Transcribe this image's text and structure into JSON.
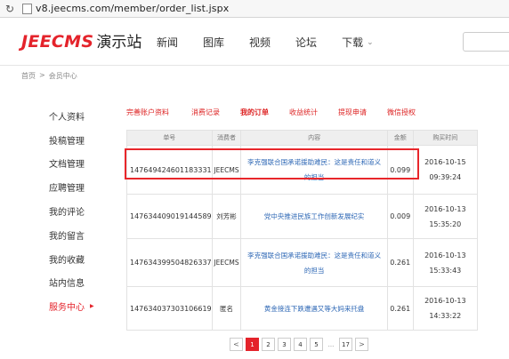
{
  "browser": {
    "url": "v8.jeecms.com/member/order_list.jspx"
  },
  "header": {
    "brand": "JEECMS",
    "site_name": "演示站",
    "nav": [
      "新闻",
      "图库",
      "视频",
      "论坛",
      "下载"
    ]
  },
  "breadcrumb": {
    "home": "首页",
    "sep": ">",
    "current": "会员中心"
  },
  "sidebar": {
    "items": [
      {
        "label": "个人资料"
      },
      {
        "label": "投稿管理"
      },
      {
        "label": "文档管理"
      },
      {
        "label": "应聘管理"
      },
      {
        "label": "我的评论"
      },
      {
        "label": "我的留言"
      },
      {
        "label": "我的收藏"
      },
      {
        "label": "站内信息"
      },
      {
        "label": "服务中心"
      }
    ]
  },
  "subtabs": [
    "完善账户资料",
    "消费记录",
    "我的订单",
    "收益统计",
    "提现申请",
    "微信授权"
  ],
  "table": {
    "headers": [
      "单号",
      "消费者",
      "内容",
      "金额",
      "购买时间"
    ],
    "rows": [
      {
        "order": "147649424601183331",
        "buyer": "JEECMS",
        "content": "李克强联合国承诺援助难民：这是责任和道义的担当",
        "amount": "0.099",
        "date": "2016-10-15",
        "time": "09:39:24"
      },
      {
        "order": "147634409019144589",
        "buyer": "刘芳彬",
        "content": "党中央推进民族工作创新发展纪实",
        "amount": "0.009",
        "date": "2016-10-13",
        "time": "15:35:20"
      },
      {
        "order": "147634399504826337",
        "buyer": "JEECMS",
        "content": "李克强联合国承诺援助难民：这是责任和道义的担当",
        "amount": "0.261",
        "date": "2016-10-13",
        "time": "15:33:43"
      },
      {
        "order": "147634037303106619",
        "buyer": "匿名",
        "content": "黄金接连下跌遭遇又等大妈来托盘",
        "amount": "0.261",
        "date": "2016-10-13",
        "time": "14:33:22"
      }
    ]
  },
  "pagination": {
    "prev": "<",
    "pages": [
      "1",
      "2",
      "3",
      "4",
      "5"
    ],
    "ellipsis": "...",
    "last": "17",
    "next": ">",
    "current": "1"
  },
  "colors": {
    "brand_red": "#e4232b",
    "link_blue": "#2d67b5"
  }
}
